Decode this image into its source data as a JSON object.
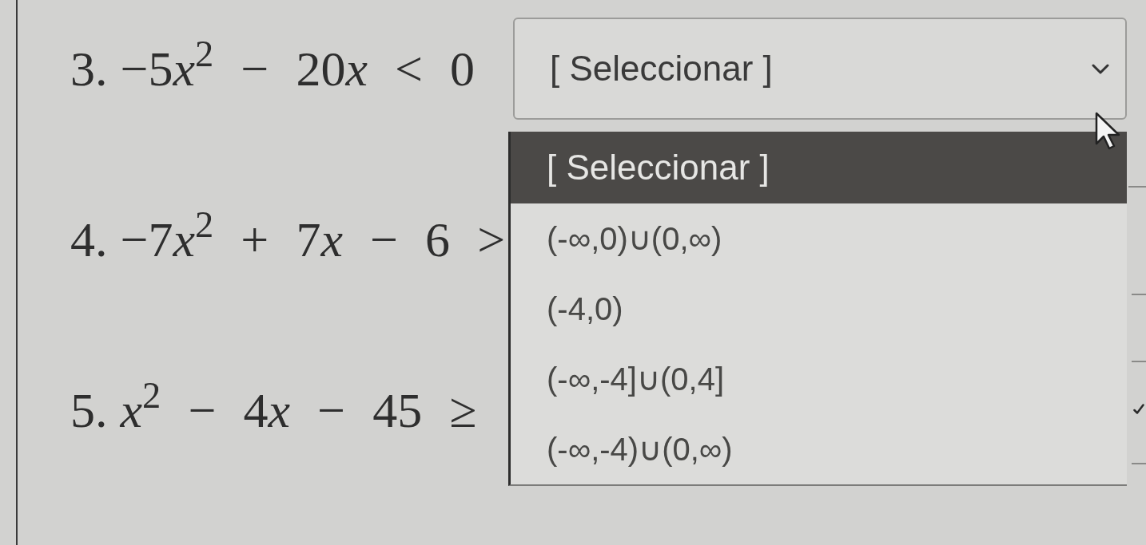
{
  "questions": [
    {
      "number": "3.",
      "expression": "−5x$^{2}$ − 20x < 0",
      "select": {
        "value": "[ Seleccionar ]",
        "expanded": true,
        "options": [
          {
            "label": "[ Seleccionar ]",
            "selected": true
          },
          {
            "label": "(-∞,0)∪(0,∞)",
            "selected": false
          },
          {
            "label": "(-4,0)",
            "selected": false
          },
          {
            "label": "(-∞,-4]∪(0,4]",
            "selected": false
          },
          {
            "label": "(-∞,-4)∪(0,∞)",
            "selected": false
          }
        ]
      }
    },
    {
      "number": "4.",
      "expression": "−7x$^{2}$ + 7x − 6 >"
    },
    {
      "number": "5.",
      "expression": "x$^{2}$ − 4x − 45 ≥"
    }
  ]
}
